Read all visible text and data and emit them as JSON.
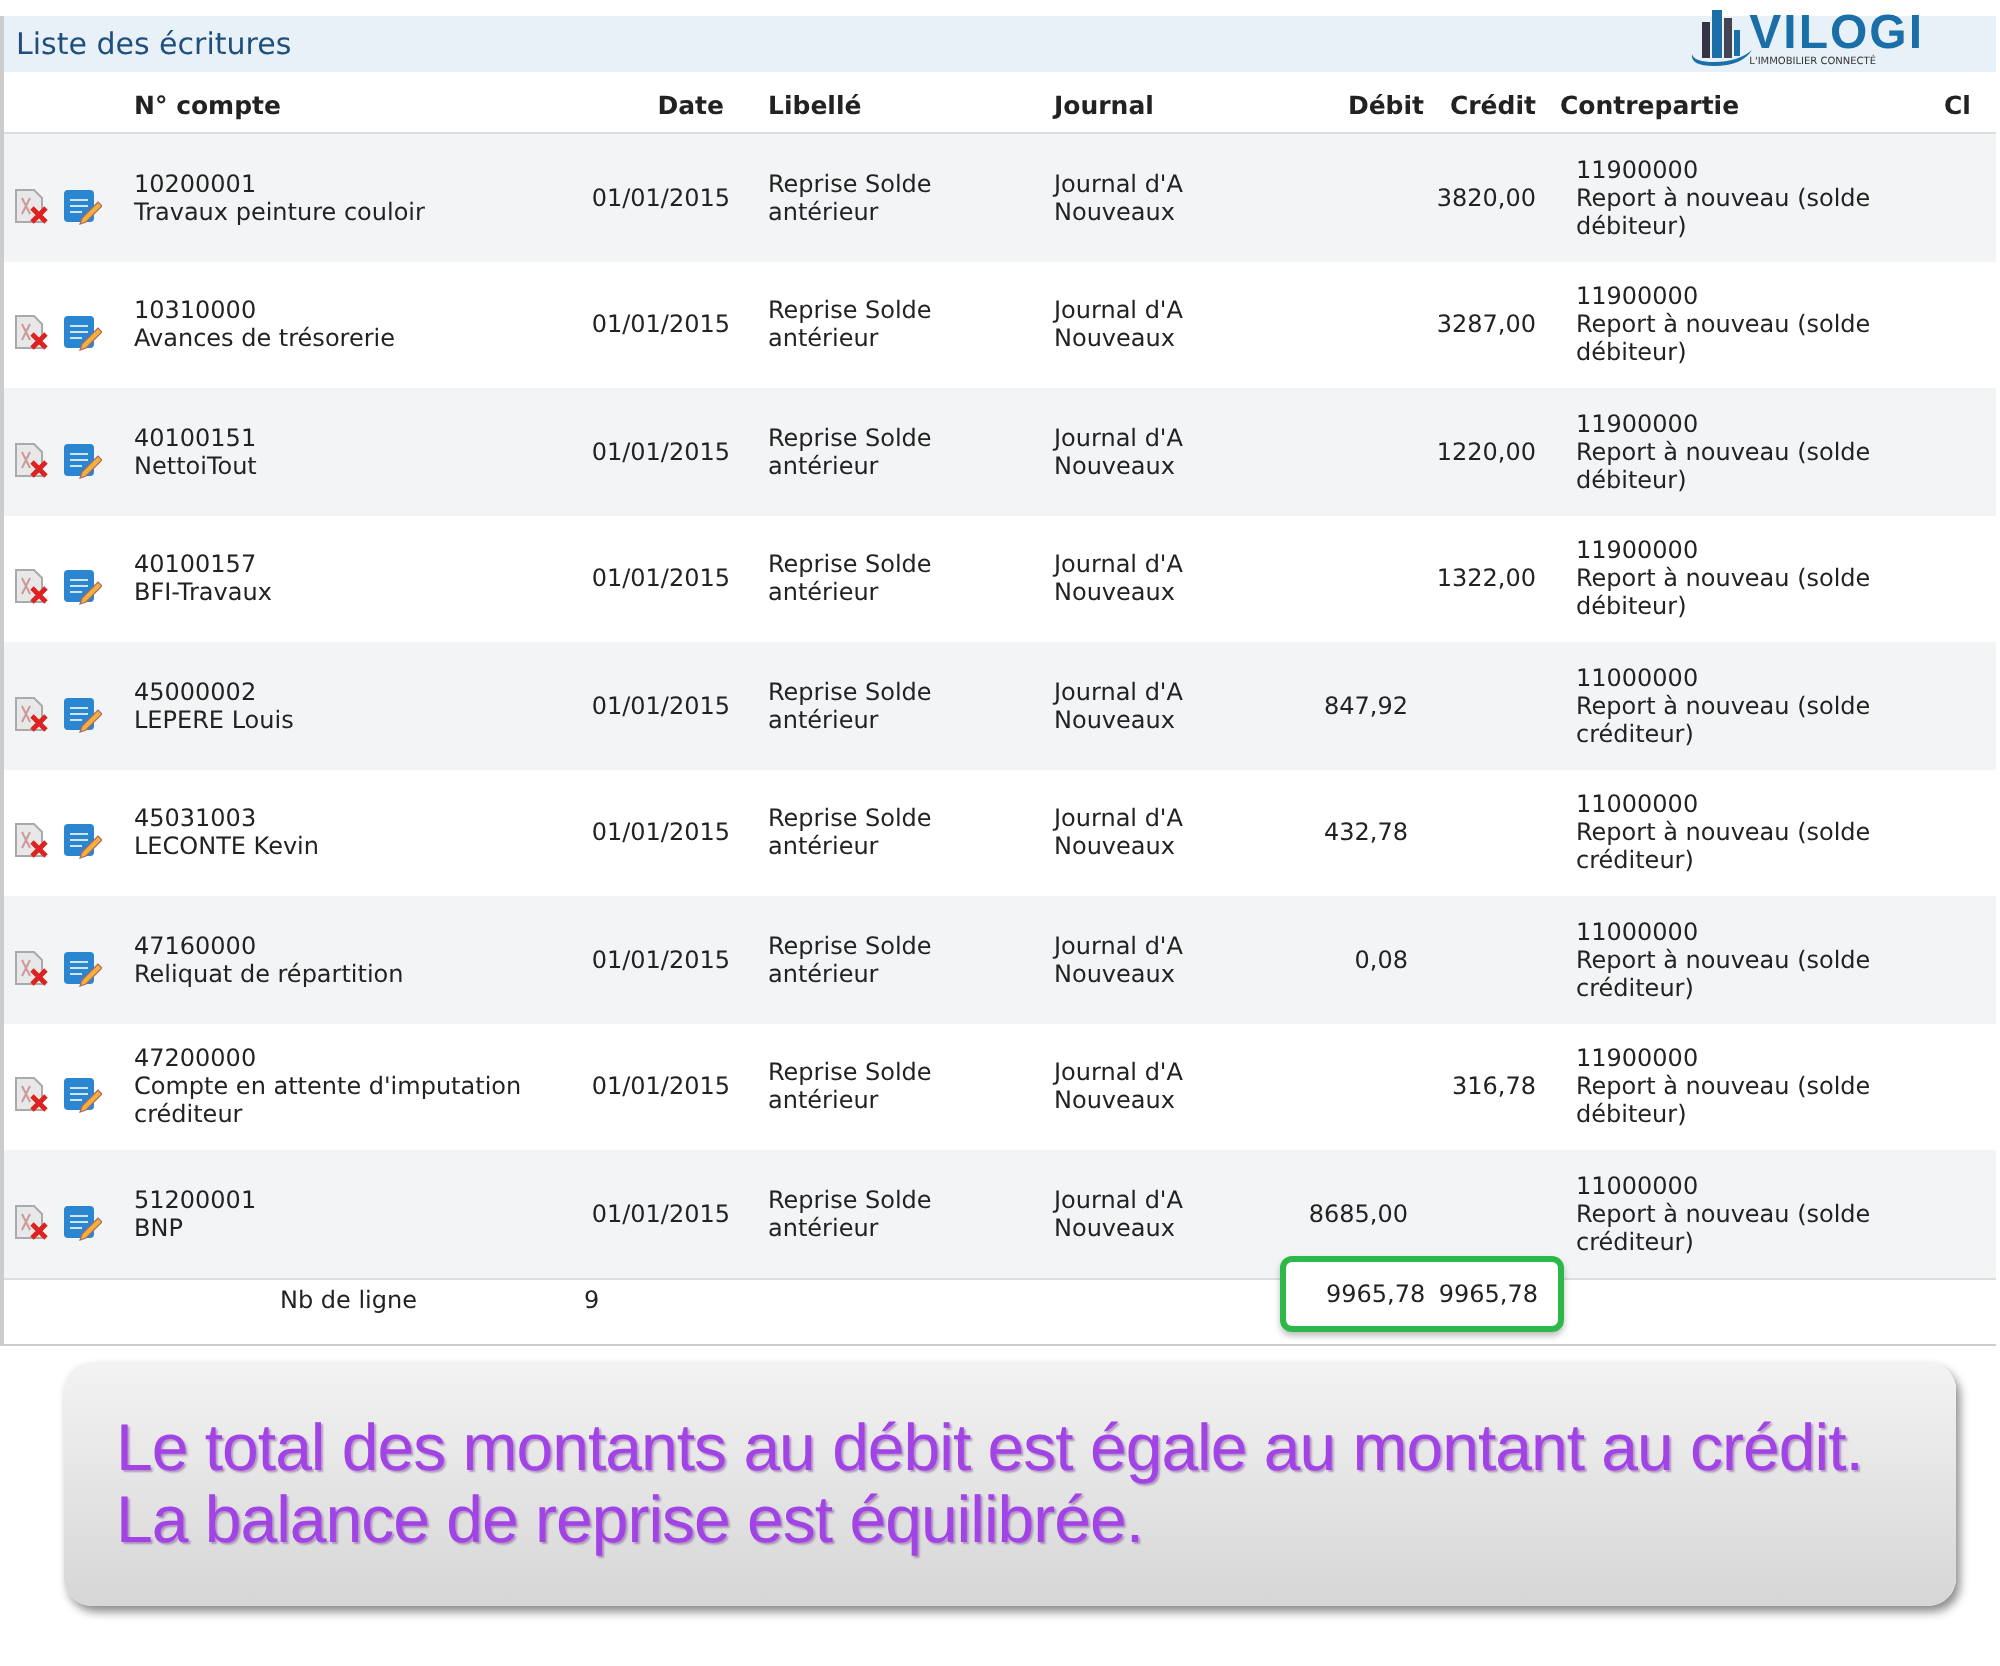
{
  "panel": {
    "title": "Liste des écritures",
    "logo": {
      "name": "VILOGI",
      "tagline": "L'IMMOBILIER CONNECTÉ"
    }
  },
  "table": {
    "columns": [
      "N° compte",
      "Date",
      "Libellé",
      "Journal",
      "Débit",
      "Crédit",
      "Contrepartie",
      "Cl"
    ],
    "rows": [
      {
        "account": "10200001",
        "account_name": "Travaux peinture couloir",
        "date": "01/01/2015",
        "label": "Reprise Solde antérieur",
        "journal": "Journal d'A Nouveaux",
        "debit": "",
        "credit": "3820,00",
        "counter_account": "11900000",
        "counter_name": "Report à nouveau (solde débiteur)"
      },
      {
        "account": "10310000",
        "account_name": "Avances de trésorerie",
        "date": "01/01/2015",
        "label": "Reprise Solde antérieur",
        "journal": "Journal d'A Nouveaux",
        "debit": "",
        "credit": "3287,00",
        "counter_account": "11900000",
        "counter_name": "Report à nouveau (solde débiteur)"
      },
      {
        "account": "40100151",
        "account_name": "NettoiTout",
        "date": "01/01/2015",
        "label": "Reprise Solde antérieur",
        "journal": "Journal d'A Nouveaux",
        "debit": "",
        "credit": "1220,00",
        "counter_account": "11900000",
        "counter_name": "Report à nouveau (solde débiteur)"
      },
      {
        "account": "40100157",
        "account_name": "BFI-Travaux",
        "date": "01/01/2015",
        "label": "Reprise Solde antérieur",
        "journal": "Journal d'A Nouveaux",
        "debit": "",
        "credit": "1322,00",
        "counter_account": "11900000",
        "counter_name": "Report à nouveau (solde débiteur)"
      },
      {
        "account": "45000002",
        "account_name": "LEPERE Louis",
        "date": "01/01/2015",
        "label": "Reprise Solde antérieur",
        "journal": "Journal d'A Nouveaux",
        "debit": "847,92",
        "credit": "",
        "counter_account": "11000000",
        "counter_name": "Report à nouveau (solde créditeur)"
      },
      {
        "account": "45031003",
        "account_name": "LECONTE Kevin",
        "date": "01/01/2015",
        "label": "Reprise Solde antérieur",
        "journal": "Journal d'A Nouveaux",
        "debit": "432,78",
        "credit": "",
        "counter_account": "11000000",
        "counter_name": "Report à nouveau (solde créditeur)"
      },
      {
        "account": "47160000",
        "account_name": "Reliquat de répartition",
        "date": "01/01/2015",
        "label": "Reprise Solde antérieur",
        "journal": "Journal d'A Nouveaux",
        "debit": "0,08",
        "credit": "",
        "counter_account": "11000000",
        "counter_name": "Report à nouveau (solde créditeur)"
      },
      {
        "account": "47200000",
        "account_name": "Compte en attente d'imputation créditeur",
        "date": "01/01/2015",
        "label": "Reprise Solde antérieur",
        "journal": "Journal d'A Nouveaux",
        "debit": "",
        "credit": "316,78",
        "counter_account": "11900000",
        "counter_name": "Report à nouveau (solde débiteur)"
      },
      {
        "account": "51200001",
        "account_name": "BNP",
        "date": "01/01/2015",
        "label": "Reprise Solde antérieur",
        "journal": "Journal d'A Nouveaux",
        "debit": "8685,00",
        "credit": "",
        "counter_account": "11000000",
        "counter_name": "Report à nouveau (solde créditeur)"
      }
    ],
    "footer": {
      "label": "Nb de ligne",
      "count": "9",
      "total_debit": "9965,78",
      "total_credit": "9965,78"
    }
  },
  "callout": {
    "lines": [
      "Le total des montants au débit est égale au montant au crédit.",
      "La balance de reprise est équilibrée."
    ]
  }
}
